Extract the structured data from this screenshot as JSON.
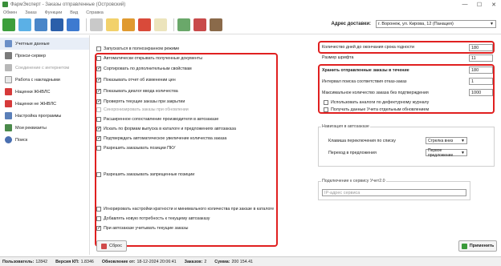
{
  "window": {
    "title": "ФармЭксперт - Заказы отправленные (Островский)"
  },
  "menu": [
    "Обмен",
    "Заказ",
    "Функции",
    "Вид",
    "Справка"
  ],
  "address": {
    "label": "Адрес доставки:",
    "value": "г. Воронеж, ул. Кирова, 12 (Панацея)"
  },
  "sidebar": {
    "items": [
      {
        "label": "Учетные данные"
      },
      {
        "label": "Прокси-сервер"
      },
      {
        "label": "Соединение с интернетом"
      },
      {
        "label": "Работа с накладными"
      },
      {
        "label": "Наценки ЖНВЛС"
      },
      {
        "label": "Наценки не ЖНВЛС"
      },
      {
        "label": "Настройка программы"
      },
      {
        "label": "Мои реквизиты"
      },
      {
        "label": "Поиск"
      }
    ]
  },
  "settings": {
    "left": [
      {
        "label": "Запускаться в полноэкранном режиме",
        "checked": false
      },
      {
        "label": "Автоматически открывать полученные документы",
        "checked": false
      },
      {
        "label": "Сортировать по дополнительным свойствам",
        "checked": true
      },
      {
        "label": "Показывать отчет об изменении цен",
        "checked": true
      },
      {
        "label": "Показывать диалог ввода количества",
        "checked": true
      },
      {
        "label": "Проверять текущие заказы при закрытии",
        "checked": true
      },
      {
        "label": "Синхронизировать заказы при обновлении",
        "checked": false
      },
      {
        "label": "Расширенное сопоставление производителя в автозаказе",
        "checked": false
      },
      {
        "label": "Искать по формам выпуска в каталоге и предложениях автозаказа",
        "checked": true
      },
      {
        "label": "Подтверждать автоматическое увеличение количества заказа",
        "checked": true
      },
      {
        "label": "Разрешить заказывать позиции ПКУ",
        "checked": false
      },
      {
        "label": "Разрешить заказывать запрещенные позиции",
        "checked": false
      },
      {
        "label": "Игнорировать настройки кратности и минимального количества при заказе в каталоге",
        "checked": false
      },
      {
        "label": "Добавлять новую потребность к текущему автозаказу",
        "checked": false
      },
      {
        "label": "При автозаказе учитывать текущие заказы",
        "checked": true
      }
    ],
    "right": {
      "days_label": "Количество дней до окончания срока годности",
      "days_value": "180",
      "font_label": "Размер шрифта",
      "font_value": "11",
      "store_label": "Хранить отправленные заказы в течение",
      "store_value": "180",
      "interval_label": "Интервал поиска соответствия отказ-заказ",
      "interval_value": "1",
      "maxqty_label": "Максимальное количество заказа без подтверждения",
      "maxqty_value": "1000",
      "use_analog_label": "Использовать аналоги по дефектурному журналу",
      "get_price_label": "Получать данные Учета отдельным обновлением"
    },
    "nav": {
      "title": "Навигация в автозаказе",
      "switch_label": "Клавиша переключения по списку",
      "switch_value": "Стрелка вниз",
      "goto_label": "Переход в предложения",
      "goto_value": "Первое предложение"
    },
    "uchet": {
      "title": "Подключение к сервису Учет2.0",
      "placeholder": "IP-адрес сервиса"
    }
  },
  "buttons": {
    "reset": "Сброс",
    "apply": "Применить"
  },
  "status": {
    "user_label": "Пользователь:",
    "user_value": "12842",
    "version_label": "Версия КП:",
    "version_value": "1.8346",
    "updated_label": "Обновление от:",
    "updated_value": "18-12-2024 20:06:41",
    "orders_label": "Заказов:",
    "orders_value": "2",
    "sum_label": "Сумма:",
    "sum_value": "200 154.41"
  },
  "colors": {
    "highlight": "#e02020",
    "active_side": "#e8eef7"
  }
}
